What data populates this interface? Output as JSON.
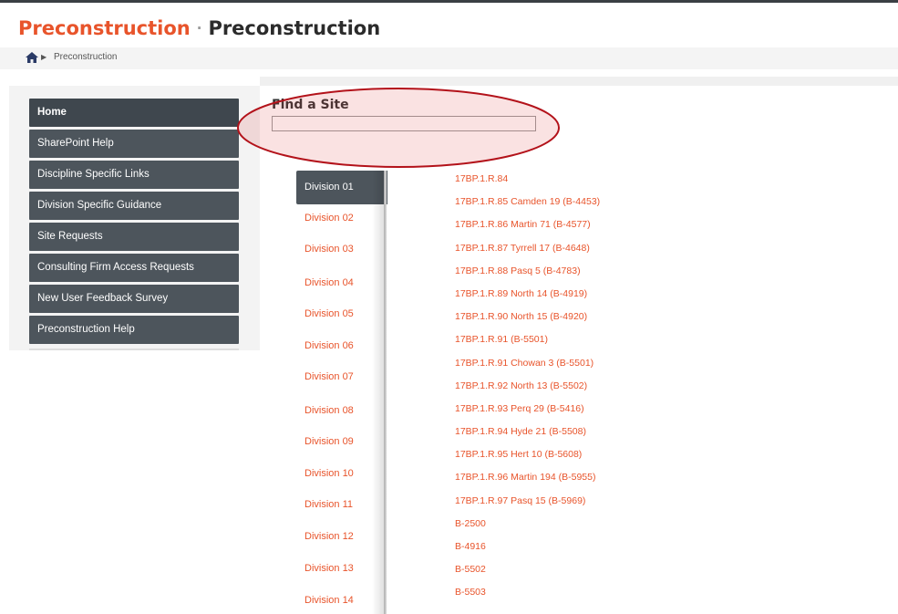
{
  "header": {
    "site_title": "Preconstruction",
    "separator": "·",
    "page_title": "Preconstruction"
  },
  "breadcrumb": {
    "home_icon": "home-icon",
    "arrow": "▶",
    "current": "Preconstruction"
  },
  "sidebar": {
    "items": [
      {
        "label": "Home",
        "active": true
      },
      {
        "label": "SharePoint Help"
      },
      {
        "label": "Discipline Specific Links"
      },
      {
        "label": "Division Specific Guidance"
      },
      {
        "label": "Site Requests"
      },
      {
        "label": "Consulting Firm Access Requests"
      },
      {
        "label": "New User Feedback Survey"
      },
      {
        "label": "Preconstruction Help"
      }
    ]
  },
  "find_site": {
    "title": "Find a Site",
    "value": "",
    "placeholder": ""
  },
  "divisions": [
    "Division 01",
    "Division 02",
    "Division 03",
    "Division 04",
    "Division 05",
    "Division 06",
    "Division 07",
    "Division 08",
    "Division 09",
    "Division 10",
    "Division 11",
    "Division 12",
    "Division 13",
    "Division 14"
  ],
  "active_division": "Division 01",
  "sites": [
    "17BP.1.R.84",
    "17BP.1.R.85 Camden 19 (B-4453)",
    "17BP.1.R.86 Martin 71 (B-4577)",
    "17BP.1.R.87 Tyrrell 17 (B-4648)",
    "17BP.1.R.88 Pasq 5 (B-4783)",
    "17BP.1.R.89 North 14 (B-4919)",
    "17BP.1.R.90 North 15 (B-4920)",
    "17BP.1.R.91 (B-5501)",
    "17BP.1.R.91 Chowan 3 (B-5501)",
    "17BP.1.R.92 North 13 (B-5502)",
    "17BP.1.R.93 Perq 29 (B-5416)",
    "17BP.1.R.94 Hyde 21 (B-5508)",
    "17BP.1.R.95 Hert 10 (B-5608)",
    "17BP.1.R.96 Martin 194 (B-5955)",
    "17BP.1.R.97 Pasq 15 (B-5969)",
    "B-2500",
    "B-4916",
    "B-5502",
    "B-5503"
  ],
  "colors": {
    "accent": "#e8542b",
    "nav_bg": "#4d555c",
    "annotation_ellipse": "#b3121a"
  }
}
